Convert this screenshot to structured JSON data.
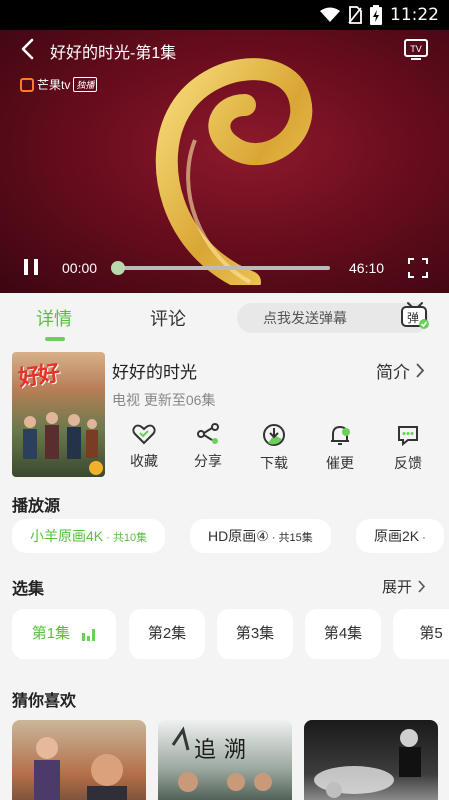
{
  "status_bar": {
    "time": "11:22",
    "icons": [
      "wifi-icon",
      "no-sim-icon",
      "battery-charging-icon"
    ]
  },
  "player": {
    "title": "好好的时光-第1集",
    "logo_text": "芒果tv",
    "logo_tag": "独播",
    "current_time": "00:00",
    "total_time": "46:10",
    "progress": 0.0,
    "accent_color": "#6bd05a"
  },
  "tabs": [
    {
      "label": "详情",
      "active": true
    },
    {
      "label": "评论",
      "active": false
    }
  ],
  "danmu": {
    "placeholder": "点我发送弹幕",
    "icon_text": "弹"
  },
  "show": {
    "poster_text": "好好",
    "title": "好好的时光",
    "subtitle": "电视 更新至06集",
    "intro_label": "简介"
  },
  "actions": [
    {
      "label": "收藏",
      "icon": "heart-icon"
    },
    {
      "label": "分享",
      "icon": "share-icon"
    },
    {
      "label": "下载",
      "icon": "download-icon"
    },
    {
      "label": "催更",
      "icon": "bell-icon"
    },
    {
      "label": "反馈",
      "icon": "feedback-icon"
    }
  ],
  "sources": {
    "title": "播放源",
    "items": [
      {
        "name": "小羊原画4K",
        "count": " · 共10集",
        "active": true
      },
      {
        "name": "HD原画④",
        "count": " · 共15集",
        "active": false
      },
      {
        "name": "原画2K",
        "count": " · ",
        "active": false
      }
    ]
  },
  "episodes": {
    "title": "选集",
    "expand_label": "展开",
    "items": [
      {
        "label": "第1集",
        "active": true
      },
      {
        "label": "第2集",
        "active": false
      },
      {
        "label": "第3集",
        "active": false
      },
      {
        "label": "第4集",
        "active": false
      },
      {
        "label": "第5",
        "active": false
      }
    ]
  },
  "recommend": {
    "title": "猜你喜欢",
    "items": [
      {
        "text": ""
      },
      {
        "text": "追溯"
      },
      {
        "text": ""
      }
    ]
  }
}
